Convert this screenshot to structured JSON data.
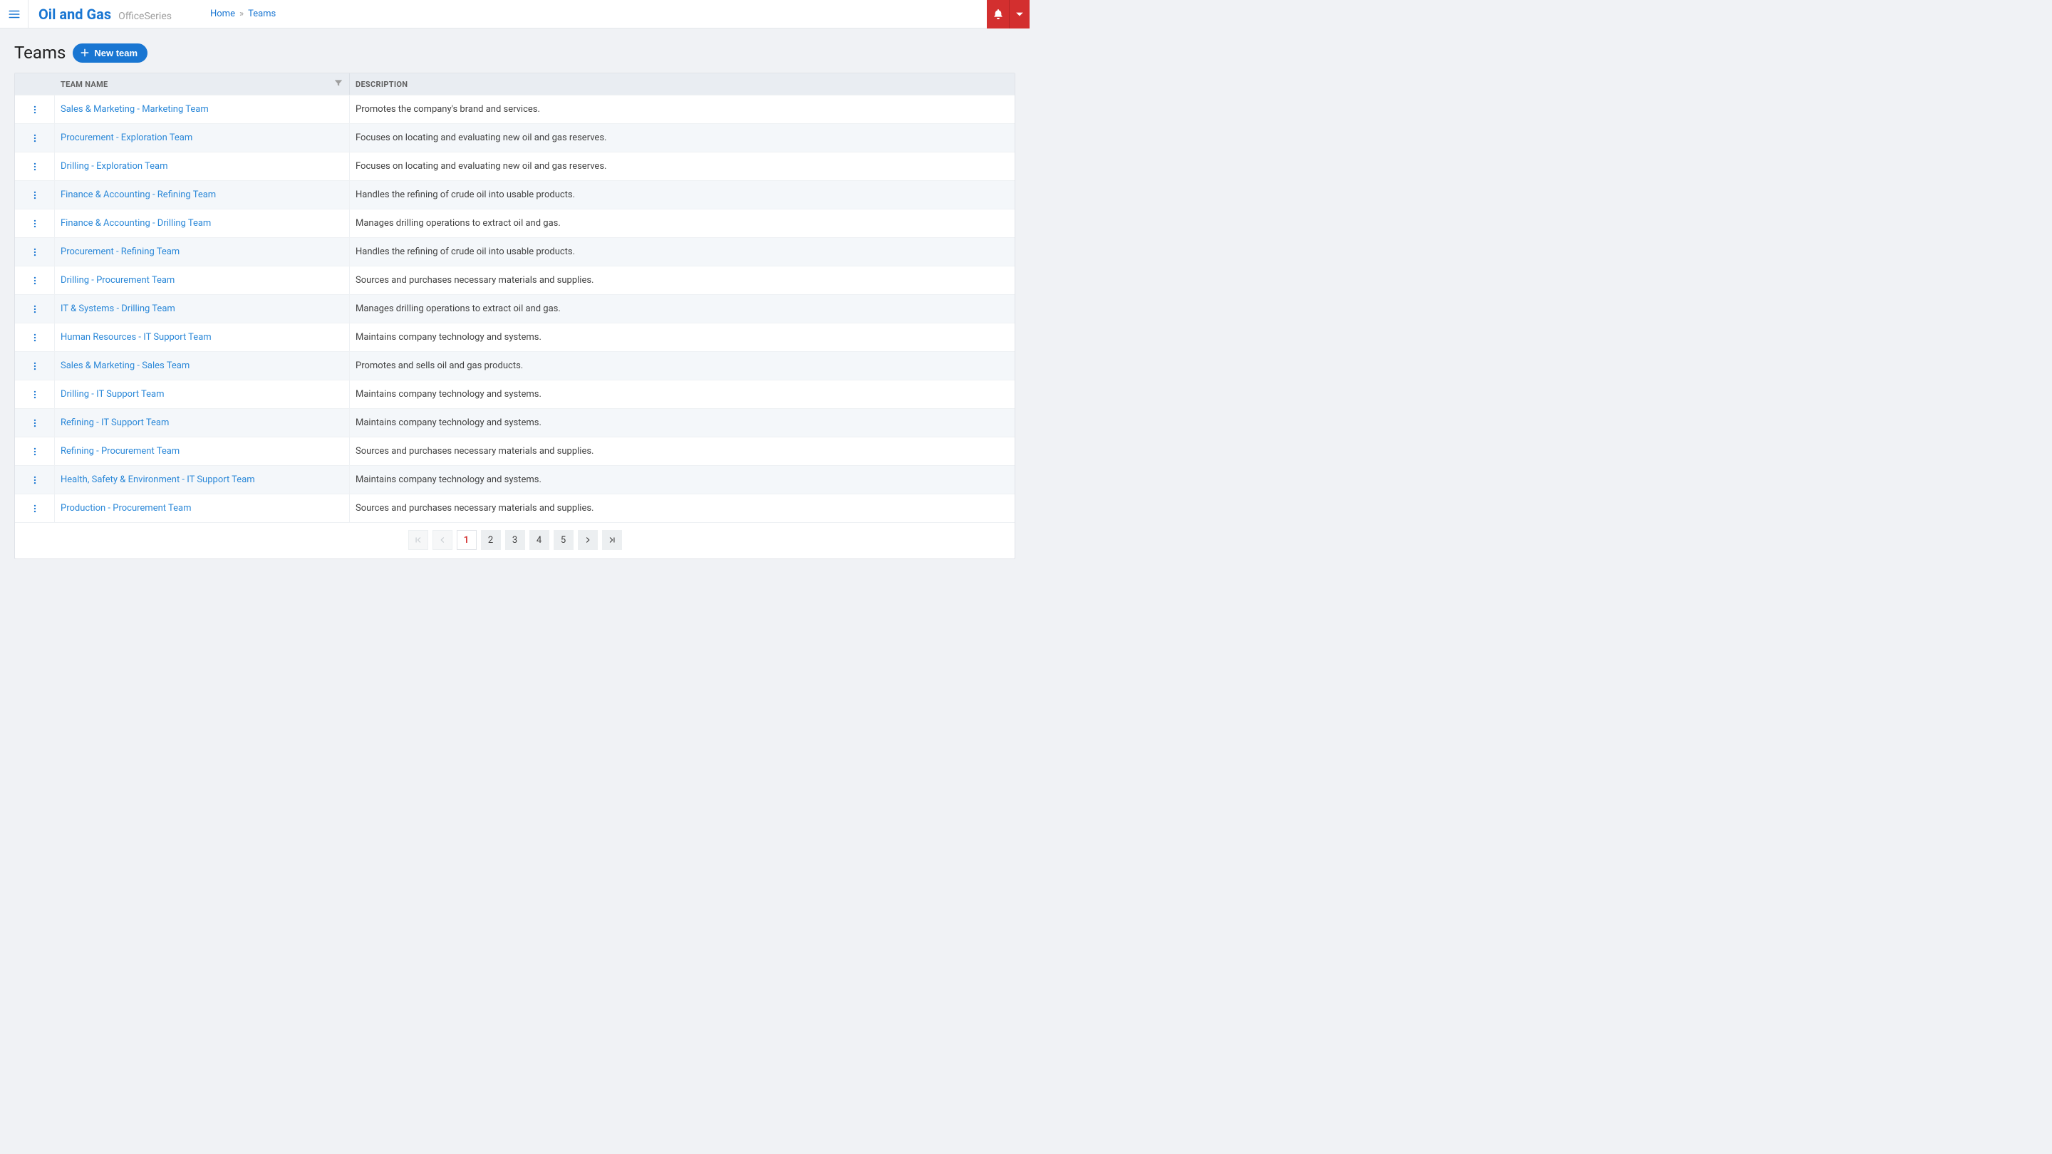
{
  "header": {
    "brand_title": "Oil and Gas",
    "brand_subtitle": "OfficeSeries"
  },
  "breadcrumbs": {
    "home_label": "Home",
    "separator": "»",
    "current_label": "Teams"
  },
  "page": {
    "title": "Teams",
    "new_button": "New team"
  },
  "table": {
    "columns": {
      "name": "TEAM NAME",
      "description": "DESCRIPTION"
    },
    "rows": [
      {
        "name": "Sales & Marketing - Marketing Team",
        "description": "Promotes the company's brand and services."
      },
      {
        "name": "Procurement - Exploration Team",
        "description": "Focuses on locating and evaluating new oil and gas reserves."
      },
      {
        "name": "Drilling - Exploration Team",
        "description": "Focuses on locating and evaluating new oil and gas reserves."
      },
      {
        "name": "Finance & Accounting - Refining Team",
        "description": "Handles the refining of crude oil into usable products."
      },
      {
        "name": "Finance & Accounting - Drilling Team",
        "description": "Manages drilling operations to extract oil and gas."
      },
      {
        "name": "Procurement - Refining Team",
        "description": "Handles the refining of crude oil into usable products."
      },
      {
        "name": "Drilling - Procurement Team",
        "description": "Sources and purchases necessary materials and supplies."
      },
      {
        "name": "IT & Systems - Drilling Team",
        "description": "Manages drilling operations to extract oil and gas."
      },
      {
        "name": "Human Resources - IT Support Team",
        "description": "Maintains company technology and systems."
      },
      {
        "name": "Sales & Marketing - Sales Team",
        "description": "Promotes and sells oil and gas products."
      },
      {
        "name": "Drilling - IT Support Team",
        "description": "Maintains company technology and systems."
      },
      {
        "name": "Refining - IT Support Team",
        "description": "Maintains company technology and systems."
      },
      {
        "name": "Refining - Procurement Team",
        "description": "Sources and purchases necessary materials and supplies."
      },
      {
        "name": "Health, Safety & Environment - IT Support Team",
        "description": "Maintains company technology and systems."
      },
      {
        "name": "Production - Procurement Team",
        "description": "Sources and purchases necessary materials and supplies."
      }
    ]
  },
  "pagination": {
    "pages": [
      "1",
      "2",
      "3",
      "4",
      "5"
    ],
    "current": "1"
  }
}
